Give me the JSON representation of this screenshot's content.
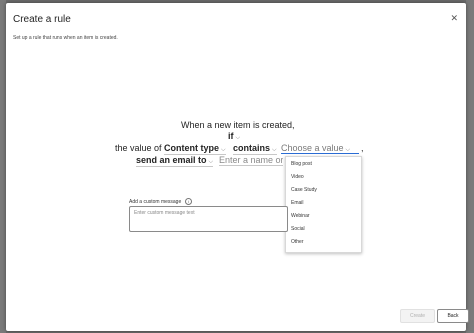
{
  "dialog": {
    "title": "Create a rule",
    "subtitle": "Set up a rule that runs when an item is created.",
    "close_icon": "close-icon"
  },
  "rule": {
    "line1": "When a new item is created,",
    "if_label": "if",
    "value_of": "the value of",
    "field": "Content type",
    "operator": "contains",
    "value_placeholder": "Choose a value",
    "comma": ",",
    "action": "send an email to",
    "recipient_placeholder": "Enter a name or"
  },
  "dropdown": {
    "options": [
      "Blog post",
      "Video",
      "Case Study",
      "Email",
      "Webinar",
      "Social",
      "Other"
    ]
  },
  "custom_message": {
    "label": "Add a custom message",
    "info_icon": "info-icon",
    "placeholder": "Enter custom message text"
  },
  "footer": {
    "create_label": "Create",
    "back_label": "Back"
  }
}
